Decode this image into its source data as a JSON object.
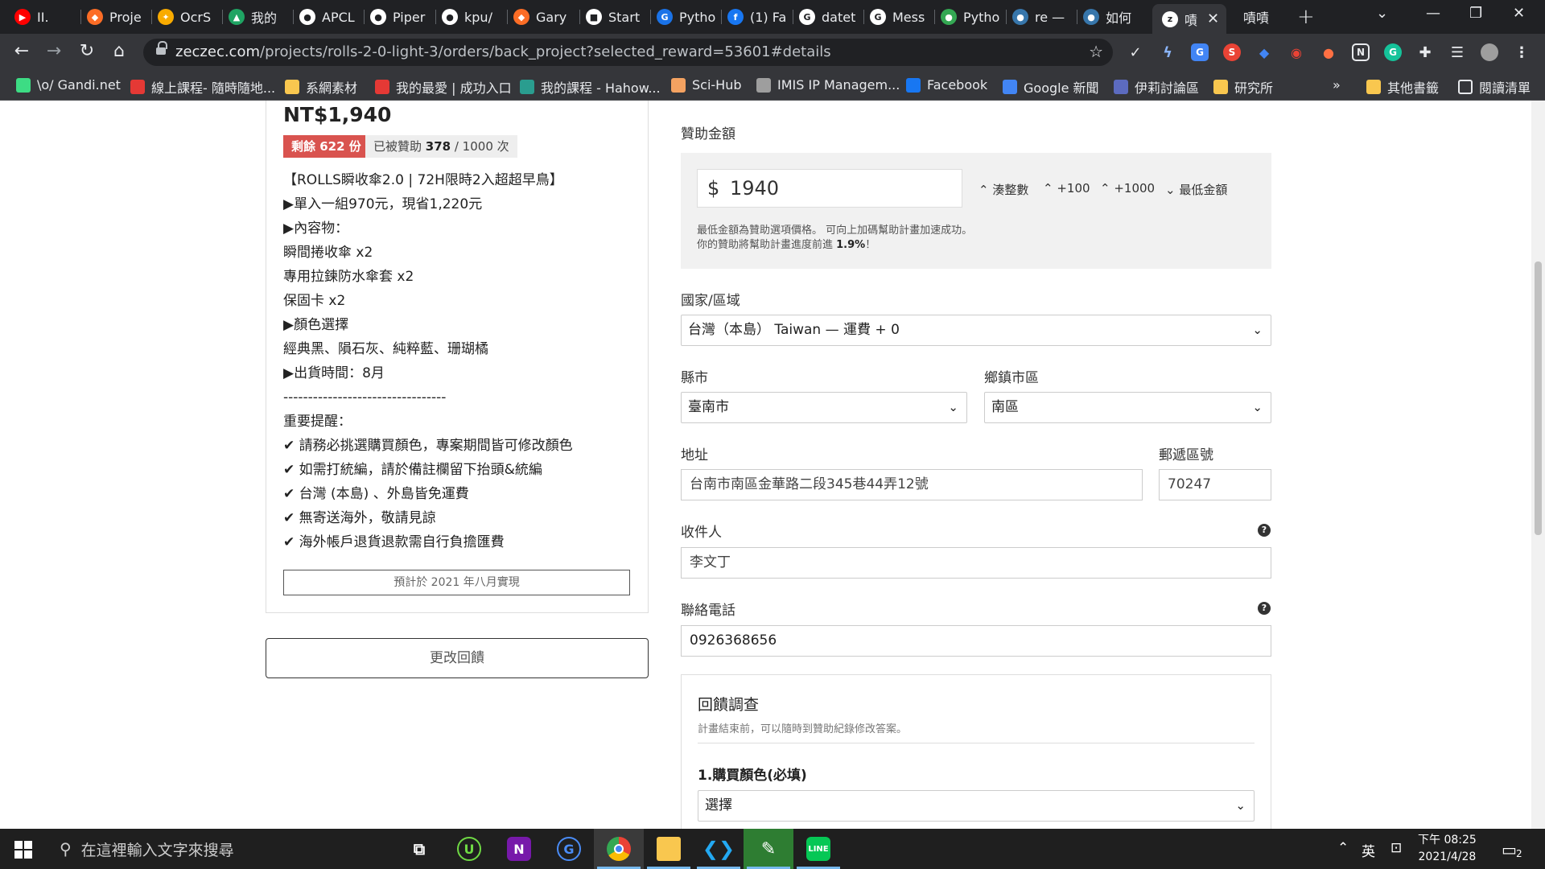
{
  "browser": {
    "tabs": [
      {
        "label": "II.",
        "color": "#ff0000",
        "glyph": "▶"
      },
      {
        "label": "Proje",
        "color": "#fc6d26",
        "glyph": "◆"
      },
      {
        "label": "OcrS",
        "color": "#f9ab00",
        "glyph": "✦"
      },
      {
        "label": "我的",
        "color": "#1fa463",
        "glyph": "▲"
      },
      {
        "label": "APCL",
        "color": "#ffffff",
        "glyph": "●"
      },
      {
        "label": "Piper",
        "color": "#ffffff",
        "glyph": "●"
      },
      {
        "label": "kpu/",
        "color": "#ffffff",
        "glyph": "●"
      },
      {
        "label": "Gary",
        "color": "#fc6d26",
        "glyph": "◆"
      },
      {
        "label": "Start",
        "color": "#ffffff",
        "glyph": "■"
      },
      {
        "label": "Pytho",
        "color": "#1a73e8",
        "glyph": "G"
      },
      {
        "label": "(1) Fa",
        "color": "#1877f2",
        "glyph": "f"
      },
      {
        "label": "datet",
        "color": "#ffffff",
        "glyph": "G"
      },
      {
        "label": "Mess",
        "color": "#ffffff",
        "glyph": "G"
      },
      {
        "label": "Pytho",
        "color": "#34a853",
        "glyph": "●"
      },
      {
        "label": "re —",
        "color": "#3776ab",
        "glyph": "●"
      },
      {
        "label": "如何",
        "color": "#3776ab",
        "glyph": "●"
      },
      {
        "label": "嘖",
        "color": "#ffffff",
        "glyph": "z",
        "active": true
      }
    ],
    "profile_label": "嘖嘖",
    "url_host": "zeczec.com",
    "url_path": "/projects/rolls-2-0-light-3/orders/back_project?selected_reward=53601#details",
    "bookmarks": [
      {
        "label": "\\o/ Gandi.net",
        "color": "#3ddc84"
      },
      {
        "label": "線上課程- 隨時隨地...",
        "color": "#e53935"
      },
      {
        "label": "系網素材",
        "color": "#f9c74f"
      },
      {
        "label": "我的最愛 | 成功入口",
        "color": "#e53935"
      },
      {
        "label": "我的課程 - Hahow...",
        "color": "#2a9d8f"
      },
      {
        "label": "Sci-Hub",
        "color": "#f4a261"
      },
      {
        "label": "IMIS IP Managem...",
        "color": "#9e9e9e"
      },
      {
        "label": "Facebook",
        "color": "#1877f2"
      },
      {
        "label": "Google 新聞",
        "color": "#4285f4"
      },
      {
        "label": "伊莉討論區",
        "color": "#5c6bc0"
      },
      {
        "label": "研究所",
        "color": "#f9c74f"
      }
    ],
    "bookmarks_more": "»",
    "other_bookmarks": "其他書籤",
    "reading_list": "閱讀清單"
  },
  "reward": {
    "price": "NT$1,940",
    "remaining": "剩餘 622 份",
    "backed_prefix": "已被贊助 ",
    "backed_count": "378",
    "backed_suffix": " / 1000 次",
    "description": "【ROLLS瞬收傘2.0 | 72H限時2入超超早鳥】\n▶單入一組970元，現省1,220元\n▶內容物：\n瞬間捲收傘 x2\n專用拉鍊防水傘套 x2\n保固卡 x2\n▶顏色選擇\n經典黑、隕石灰、純粹藍、珊瑚橘\n▶出貨時間：8月\n---------------------------------\n重要提醒：\n✔ 請務必挑選購買顏色，專案期間皆可修改顏色\n✔ 如需打統編，請於備註欄留下抬頭&統編\n✔ 台灣 (本島) 、外島皆免運費\n✔ 無寄送海外，敬請見諒\n✔ 海外帳戶退貨退款需自行負擔匯費",
    "eta": "預計於 2021 年八月實現",
    "change_button": "更改回饋"
  },
  "form": {
    "amount_label": "贊助金額",
    "currency": "$",
    "amount": "1940",
    "options": [
      "湊整數",
      "+100",
      "+1000",
      "最低金額"
    ],
    "note_line1": "最低金額為贊助選項價格。 可向上加碼幫助計畫加速成功。",
    "note_line2_prefix": "你的贊助將幫助計畫進度前進 ",
    "note_percent": "1.9%",
    "note_line2_suffix": "！",
    "country_label": "國家/區域",
    "country_value": "台灣（本島） Taiwan — 運費 + 0",
    "county_label": "縣市",
    "county_value": "臺南市",
    "district_label": "鄉鎮市區",
    "district_value": "南區",
    "address_label": "地址",
    "address_value": "台南市南區金華路二段345巷44弄12號",
    "zip_label": "郵遞區號",
    "zip_value": "70247",
    "recipient_label": "收件人",
    "recipient_value": "李文丁",
    "phone_label": "聯絡電話",
    "phone_value": "0926368656",
    "survey_title": "回饋調查",
    "survey_sub": "計畫結束前，可以隨時到贊助紀錄修改答案。",
    "survey_q1": "1.購買顏色(必填)",
    "survey_q1_value": "選擇"
  },
  "taskbar": {
    "search_placeholder": "在這裡輸入文字來搜尋",
    "ime": "英",
    "time": "下午 08:25",
    "date": "2021/4/28",
    "notifications": "2"
  }
}
